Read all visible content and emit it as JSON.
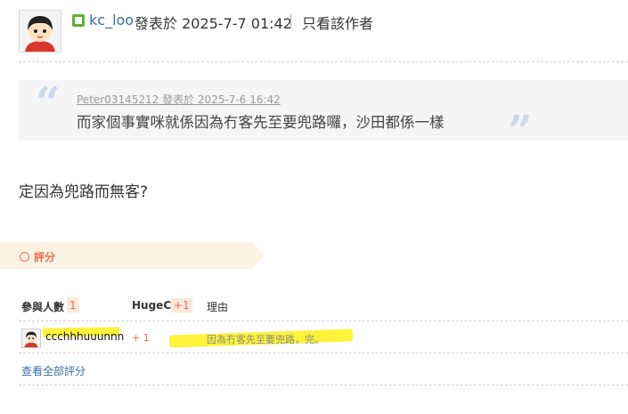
{
  "post": {
    "author": "kc_loo",
    "posted_label": "發表於 2025-7-7 01:42",
    "separator": "|",
    "only_author_label": "只看該作者",
    "quote": {
      "meta": "Peter03145212 發表於 2025-7-6 16:42",
      "text": "而家個事實咪就係因為冇客先至要兜路囉，沙田都係一樣",
      "open_mark": "“",
      "close_mark": "”"
    },
    "body": "定因為兜路而無客?"
  },
  "rating": {
    "label": "評分",
    "headers": {
      "participants_label": "參與人數",
      "participants_count": "1",
      "currency_label": "HugeC",
      "currency_total": "+1",
      "reason_label": "理由"
    },
    "rows": [
      {
        "user": "ccchhhuuunnn",
        "score": "+ 1",
        "reason": "因為冇客先至要兜路，完。"
      }
    ],
    "view_all_label": "查看全部評分"
  },
  "colors": {
    "link": "#3a6ea5",
    "accent": "#f26c4f",
    "highlight": "#fff23a",
    "quote_mark": "#c9d8ea"
  },
  "icons": {
    "online": "online-status-icon",
    "rate": "rate-circle-icon"
  }
}
